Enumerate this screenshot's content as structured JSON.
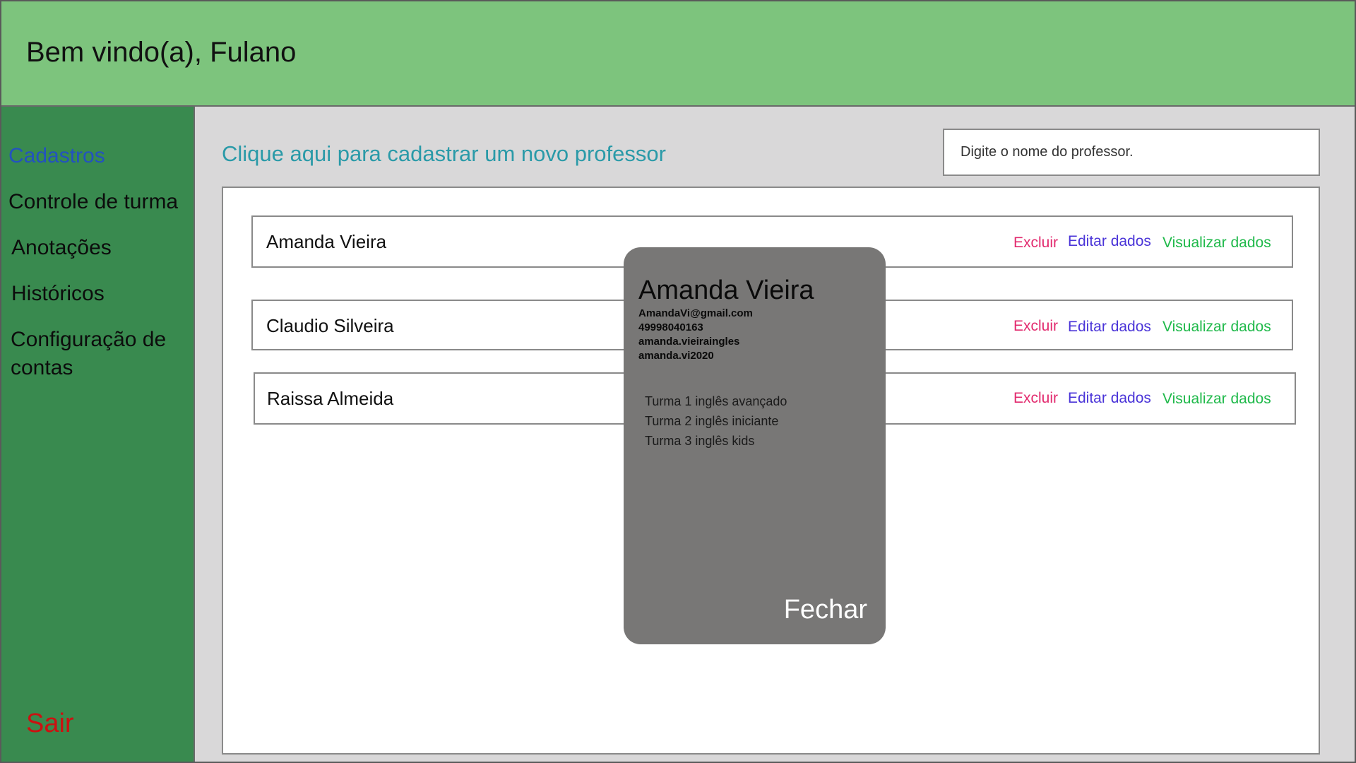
{
  "header": {
    "greeting": "Bem vindo(a), Fulano"
  },
  "sidebar": {
    "items": [
      {
        "label": "Cadastros",
        "active": true
      },
      {
        "label": "Controle de turma"
      },
      {
        "label": "Anotações"
      },
      {
        "label": "Históricos"
      },
      {
        "label": "Configuração de contas"
      }
    ],
    "exit_label": "Sair"
  },
  "main": {
    "new_link": "Clique aqui para cadastrar um novo professor",
    "search_placeholder": "Digite o nome do professor.",
    "rows": [
      {
        "name": "Amanda Vieira",
        "delete": "Excluir",
        "edit": "Editar dados",
        "view": "Visualizar dados"
      },
      {
        "name": "Claudio Silveira",
        "delete": "Excluir",
        "edit": "Editar dados",
        "view": "Visualizar dados"
      },
      {
        "name": "Raissa Almeida",
        "delete": "Excluir",
        "edit": "Editar dados",
        "view": "Visualizar dados"
      }
    ]
  },
  "modal": {
    "name": "Amanda Vieira",
    "email": "AmandaVi@gmail.com",
    "phone": "49998040163",
    "username": "amanda.vieiraingles",
    "password": "amanda.vi2020",
    "classes": [
      "Turma 1 inglês avançado",
      "Turma 2 inglês iniciante",
      "Turma 3 inglês kids"
    ],
    "close_label": "Fechar"
  },
  "colors": {
    "header_bg": "#7dc47d",
    "sidebar_bg": "#398a4f",
    "active_link": "#2352c0",
    "exit": "#cc1111",
    "delete": "#e22a6e",
    "edit": "#4a34d8",
    "view": "#1fb94a",
    "modal_bg": "#787776"
  }
}
